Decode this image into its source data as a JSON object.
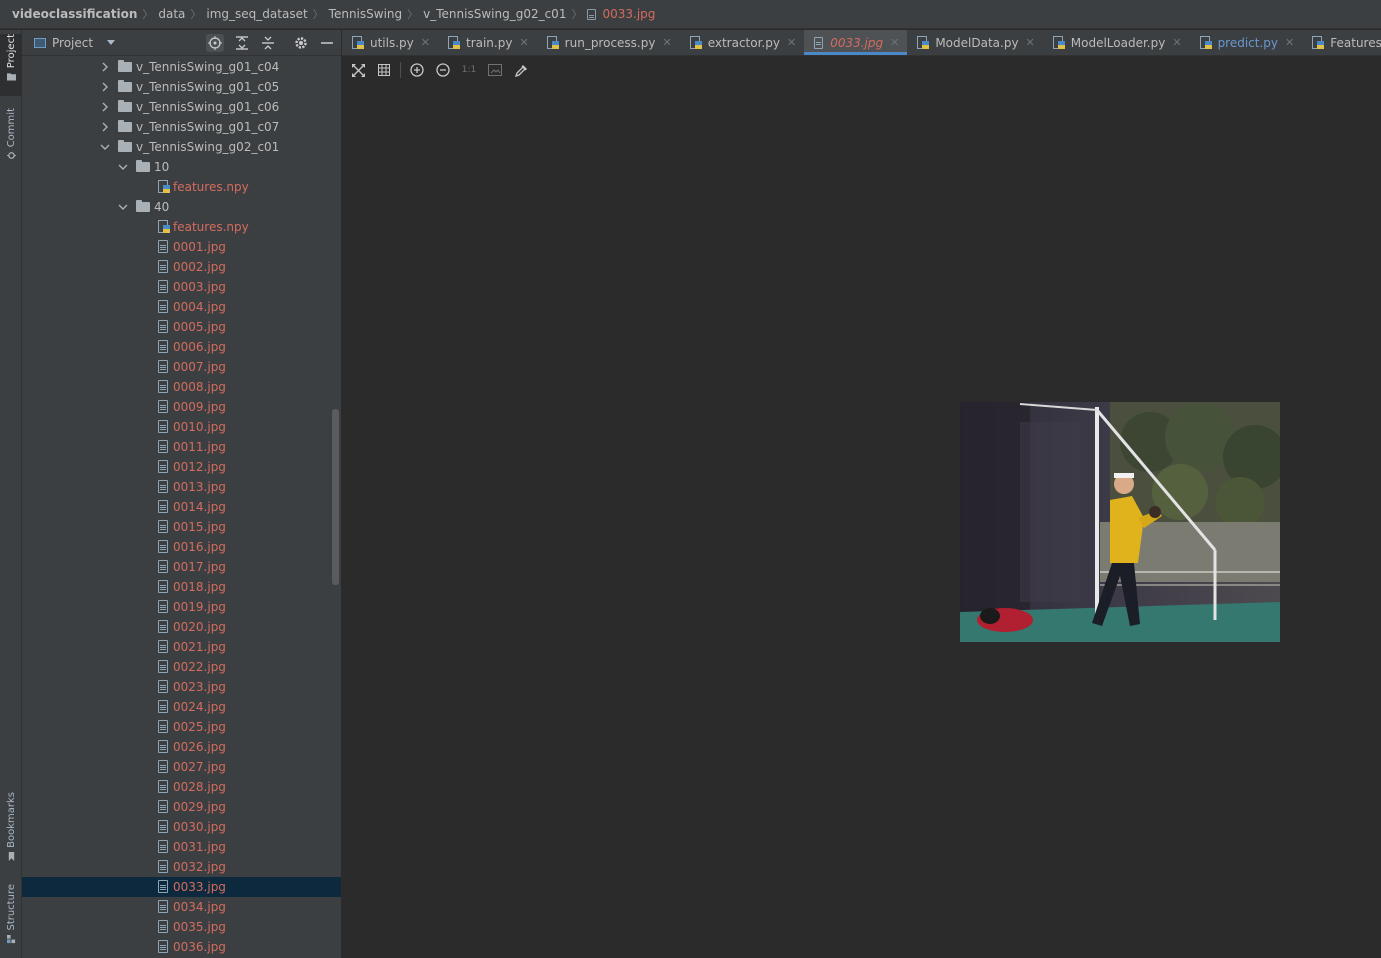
{
  "breadcrumb": {
    "items": [
      "videoclassification",
      "data",
      "img_seq_dataset",
      "TennisSwing",
      "v_TennisSwing_g02_c01"
    ],
    "file": "0033.jpg"
  },
  "left_strip": {
    "tabs": [
      {
        "label": "Project",
        "icon": "folder-icon",
        "active": true
      },
      {
        "label": "Commit",
        "icon": "commit-icon",
        "active": false
      },
      {
        "label": "Bookmarks",
        "icon": "bookmark-icon",
        "active": false
      },
      {
        "label": "Structure",
        "icon": "structure-icon",
        "active": false
      }
    ]
  },
  "project_panel": {
    "title": "Project",
    "header_icons": [
      "locate-icon",
      "expand-all-icon",
      "collapse-all-icon",
      "gear-icon",
      "minimize-icon"
    ]
  },
  "tree": {
    "rows": [
      {
        "label": "v_TennisSwing_g01_c04",
        "type": "folder",
        "depth": 0,
        "expanded": false,
        "color": "normal"
      },
      {
        "label": "v_TennisSwing_g01_c05",
        "type": "folder",
        "depth": 0,
        "expanded": false,
        "color": "normal"
      },
      {
        "label": "v_TennisSwing_g01_c06",
        "type": "folder",
        "depth": 0,
        "expanded": false,
        "color": "normal"
      },
      {
        "label": "v_TennisSwing_g01_c07",
        "type": "folder",
        "depth": 0,
        "expanded": false,
        "color": "normal"
      },
      {
        "label": "v_TennisSwing_g02_c01",
        "type": "folder",
        "depth": 0,
        "expanded": true,
        "color": "normal"
      },
      {
        "label": "10",
        "type": "folder",
        "depth": 1,
        "expanded": true,
        "color": "normal"
      },
      {
        "label": "features.npy",
        "type": "npy",
        "depth": 2,
        "color": "red"
      },
      {
        "label": "40",
        "type": "folder",
        "depth": 1,
        "expanded": true,
        "color": "normal"
      },
      {
        "label": "features.npy",
        "type": "npy",
        "depth": 2,
        "color": "red"
      },
      {
        "label": "0001.jpg",
        "type": "jpg",
        "depth": 1,
        "color": "red"
      },
      {
        "label": "0002.jpg",
        "type": "jpg",
        "depth": 1,
        "color": "red"
      },
      {
        "label": "0003.jpg",
        "type": "jpg",
        "depth": 1,
        "color": "red"
      },
      {
        "label": "0004.jpg",
        "type": "jpg",
        "depth": 1,
        "color": "red"
      },
      {
        "label": "0005.jpg",
        "type": "jpg",
        "depth": 1,
        "color": "red"
      },
      {
        "label": "0006.jpg",
        "type": "jpg",
        "depth": 1,
        "color": "red"
      },
      {
        "label": "0007.jpg",
        "type": "jpg",
        "depth": 1,
        "color": "red"
      },
      {
        "label": "0008.jpg",
        "type": "jpg",
        "depth": 1,
        "color": "red"
      },
      {
        "label": "0009.jpg",
        "type": "jpg",
        "depth": 1,
        "color": "red"
      },
      {
        "label": "0010.jpg",
        "type": "jpg",
        "depth": 1,
        "color": "red"
      },
      {
        "label": "0011.jpg",
        "type": "jpg",
        "depth": 1,
        "color": "red"
      },
      {
        "label": "0012.jpg",
        "type": "jpg",
        "depth": 1,
        "color": "red"
      },
      {
        "label": "0013.jpg",
        "type": "jpg",
        "depth": 1,
        "color": "red"
      },
      {
        "label": "0014.jpg",
        "type": "jpg",
        "depth": 1,
        "color": "red"
      },
      {
        "label": "0015.jpg",
        "type": "jpg",
        "depth": 1,
        "color": "red"
      },
      {
        "label": "0016.jpg",
        "type": "jpg",
        "depth": 1,
        "color": "red"
      },
      {
        "label": "0017.jpg",
        "type": "jpg",
        "depth": 1,
        "color": "red"
      },
      {
        "label": "0018.jpg",
        "type": "jpg",
        "depth": 1,
        "color": "red"
      },
      {
        "label": "0019.jpg",
        "type": "jpg",
        "depth": 1,
        "color": "red"
      },
      {
        "label": "0020.jpg",
        "type": "jpg",
        "depth": 1,
        "color": "red"
      },
      {
        "label": "0021.jpg",
        "type": "jpg",
        "depth": 1,
        "color": "red"
      },
      {
        "label": "0022.jpg",
        "type": "jpg",
        "depth": 1,
        "color": "red"
      },
      {
        "label": "0023.jpg",
        "type": "jpg",
        "depth": 1,
        "color": "red"
      },
      {
        "label": "0024.jpg",
        "type": "jpg",
        "depth": 1,
        "color": "red"
      },
      {
        "label": "0025.jpg",
        "type": "jpg",
        "depth": 1,
        "color": "red"
      },
      {
        "label": "0026.jpg",
        "type": "jpg",
        "depth": 1,
        "color": "red"
      },
      {
        "label": "0027.jpg",
        "type": "jpg",
        "depth": 1,
        "color": "red"
      },
      {
        "label": "0028.jpg",
        "type": "jpg",
        "depth": 1,
        "color": "red"
      },
      {
        "label": "0029.jpg",
        "type": "jpg",
        "depth": 1,
        "color": "red"
      },
      {
        "label": "0030.jpg",
        "type": "jpg",
        "depth": 1,
        "color": "red"
      },
      {
        "label": "0031.jpg",
        "type": "jpg",
        "depth": 1,
        "color": "red"
      },
      {
        "label": "0032.jpg",
        "type": "jpg",
        "depth": 1,
        "color": "red"
      },
      {
        "label": "0033.jpg",
        "type": "jpg",
        "depth": 1,
        "color": "red",
        "selected": true
      },
      {
        "label": "0034.jpg",
        "type": "jpg",
        "depth": 1,
        "color": "red"
      },
      {
        "label": "0035.jpg",
        "type": "jpg",
        "depth": 1,
        "color": "red"
      },
      {
        "label": "0036.jpg",
        "type": "jpg",
        "depth": 1,
        "color": "red"
      }
    ]
  },
  "tabs": [
    {
      "label": "utils.py",
      "icon": "python-file-icon",
      "style": "normal"
    },
    {
      "label": "train.py",
      "icon": "python-file-icon",
      "style": "normal"
    },
    {
      "label": "run_process.py",
      "icon": "python-file-icon",
      "style": "normal"
    },
    {
      "label": "extractor.py",
      "icon": "python-file-icon",
      "style": "normal"
    },
    {
      "label": "0033.jpg",
      "icon": "image-file-icon",
      "style": "italic",
      "active": true
    },
    {
      "label": "ModelData.py",
      "icon": "python-file-icon",
      "style": "normal"
    },
    {
      "label": "ModelLoader.py",
      "icon": "python-file-icon",
      "style": "normal"
    },
    {
      "label": "predict.py",
      "icon": "python-file-icon",
      "style": "blue"
    },
    {
      "label": "FeaturesExtractor.py",
      "icon": "python-file-icon",
      "style": "normal"
    }
  ],
  "image_toolbar": {
    "actual_size_label": "1:1",
    "icons": [
      "fit-to-window-icon",
      "grid-icon",
      "zoom-in-icon",
      "zoom-out-icon",
      "actual-size-icon",
      "background-icon",
      "color-picker-icon"
    ]
  },
  "colors": {
    "accent": "#4a88c7",
    "modified_file": "#d36c5f",
    "selection": "#0d293e",
    "panel_bg": "#3c3f41",
    "editor_bg": "#2b2b2b"
  }
}
